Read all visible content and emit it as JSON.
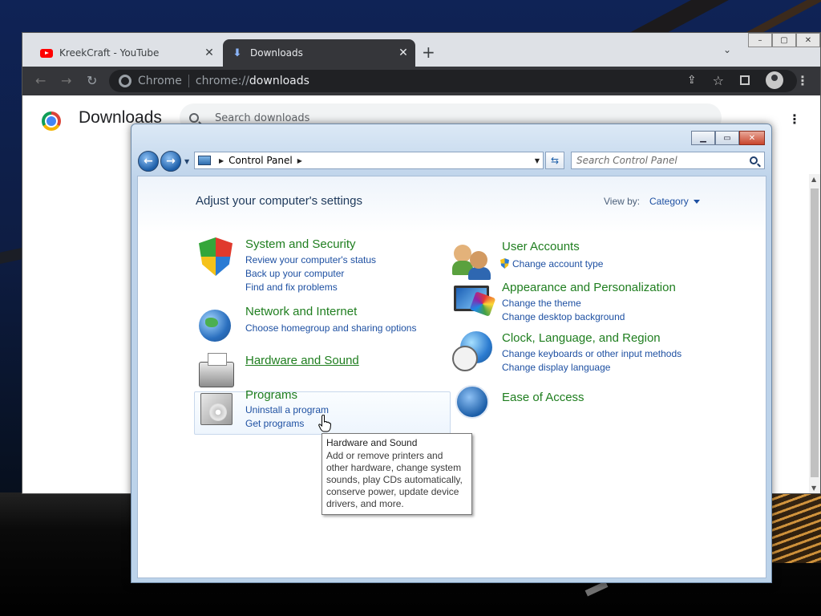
{
  "chrome": {
    "tabs": [
      {
        "title": "KreekCraft - YouTube",
        "close": "✕"
      },
      {
        "title": "Downloads",
        "close": "✕"
      }
    ],
    "new_tab": "+",
    "tab_search": "⌄",
    "window_buttons": {
      "minimize": "–",
      "maximize": "▢",
      "close": "✕"
    },
    "nav": {
      "back": "←",
      "forward": "→",
      "reload": "↻"
    },
    "omnibox": {
      "scheme_label": "Chrome",
      "url_prefix": "chrome://",
      "url_host": "downloads"
    },
    "toolbar": {
      "share": "⇪",
      "star": "☆",
      "menu": "⋮"
    }
  },
  "downloads_page": {
    "title": "Downloads",
    "search_placeholder": "Search downloads",
    "menu": "⋮",
    "scroll_up": "▲",
    "scroll_down": "▼"
  },
  "control_panel": {
    "caption_buttons": {
      "minimize": "▁",
      "maximize": "▭",
      "close": "✕"
    },
    "nav": {
      "back": "←",
      "forward": "→",
      "history": "▼"
    },
    "address": {
      "crumb_arrow": "▶",
      "crumb": "Control Panel",
      "crumb_end": "▶",
      "dropdown": "▼"
    },
    "refresh": "⇆",
    "search_placeholder": "Search Control Panel",
    "heading": "Adjust your computer's settings",
    "view_by_label": "View by:",
    "view_by_value": "Category",
    "categories": {
      "system_security": {
        "title": "System and Security",
        "links": [
          "Review your computer's status",
          "Back up your computer",
          "Find and fix problems"
        ]
      },
      "network": {
        "title": "Network and Internet",
        "links": [
          "Choose homegroup and sharing options"
        ]
      },
      "hardware": {
        "title": "Hardware and Sound",
        "links": []
      },
      "programs": {
        "title": "Programs",
        "links": [
          "Uninstall a program",
          "Get programs"
        ]
      },
      "user_accounts": {
        "title": "User Accounts",
        "links": [
          "Change account type"
        ]
      },
      "appearance": {
        "title": "Appearance and Personalization",
        "links": [
          "Change the theme",
          "Change desktop background"
        ]
      },
      "clock": {
        "title": "Clock, Language, and Region",
        "links": [
          "Change keyboards or other input methods",
          "Change display language"
        ]
      },
      "ease": {
        "title": "Ease of Access",
        "links": []
      }
    },
    "tooltip": {
      "title": "Hardware and Sound",
      "body": "Add or remove printers and other hardware, change system sounds, play CDs automatically, conserve power, update device drivers, and more."
    }
  }
}
